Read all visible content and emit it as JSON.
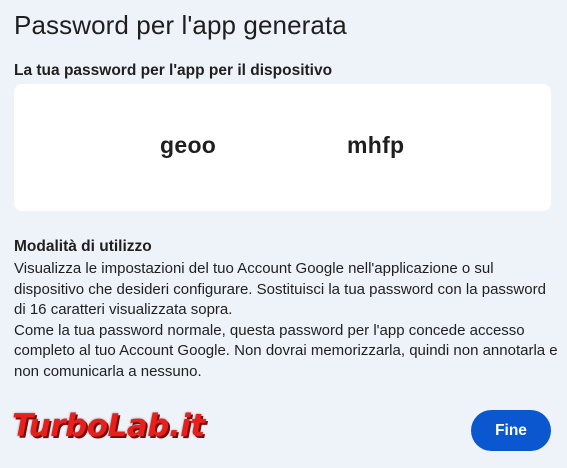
{
  "dialog": {
    "title": "Password per l'app generata",
    "password_label": "La tua password per l'app per il dispositivo",
    "password_groups": [
      "geoo",
      "mhfp"
    ],
    "usage_title": "Modalità di utilizzo",
    "usage_paragraphs": [
      "Visualizza le impostazioni del tuo Account Google nell'applicazione o sul dispositivo che desideri configurare. Sostituisci la tua password con la password di 16 caratteri visualizzata sopra.",
      "Come la tua password normale, questa password per l'app concede accesso completo al tuo Account Google. Non dovrai memorizzarla, quindi non annotarla e non comunicarla a nessuno."
    ],
    "done_label": "Fine"
  },
  "watermark": {
    "text": "TurboLab.it"
  },
  "colors": {
    "background": "#eef2f9",
    "card": "#ffffff",
    "primary_button": "#0b57d0",
    "text": "#1f1f1f",
    "watermark": "#e8201c"
  }
}
